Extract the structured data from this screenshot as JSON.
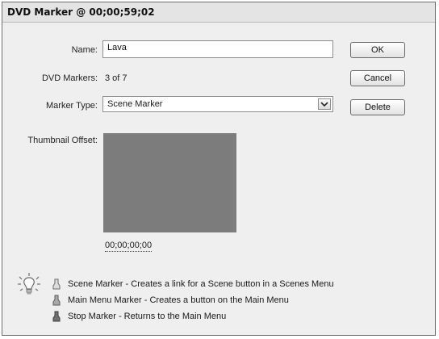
{
  "window": {
    "title": "DVD Marker @ 00;00;59;02"
  },
  "form": {
    "name_label": "Name:",
    "name_value": "Lava",
    "markers_label": "DVD Markers:",
    "markers_value": "3 of 7",
    "type_label": "Marker Type:",
    "type_value": "Scene Marker",
    "thumb_label": "Thumbnail Offset:",
    "thumb_timecode": "00;00;00;00"
  },
  "buttons": {
    "ok": "OK",
    "cancel": "Cancel",
    "delete": "Delete"
  },
  "legend": [
    {
      "text": "Scene Marker - Creates a link for a Scene button in a Scenes Menu"
    },
    {
      "text": "Main Menu Marker - Creates a button on the Main Menu"
    },
    {
      "text": "Stop Marker - Returns to the Main Menu"
    }
  ],
  "icons": {
    "tip": "lightbulb-icon",
    "scene": "scene-marker-icon",
    "main_menu": "main-menu-marker-icon",
    "stop": "stop-marker-icon",
    "dropdown": "chevron-down-icon"
  }
}
